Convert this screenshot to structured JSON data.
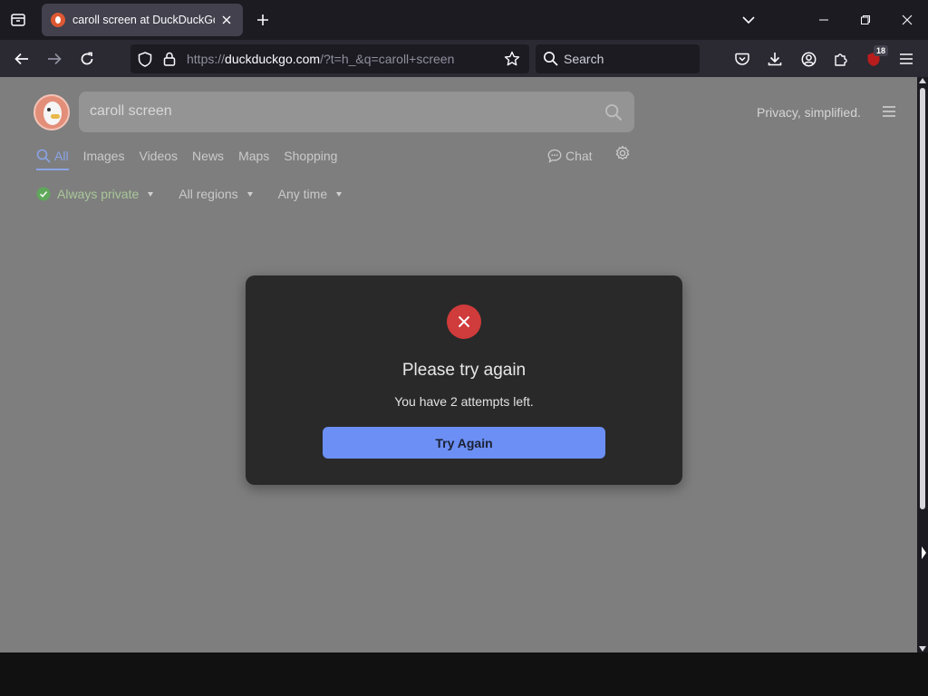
{
  "browser": {
    "tab_title": "caroll screen at DuckDuckGo",
    "url_prefix": "https://",
    "url_host": "duckduckgo.com",
    "url_path": "/?t=h_&q=caroll+screen",
    "search_placeholder": "Search",
    "extensions_badge": "18"
  },
  "ddg": {
    "query": "caroll screen",
    "tagline": "Privacy, simplified.",
    "tabs": [
      {
        "label": "All",
        "active": true
      },
      {
        "label": "Images"
      },
      {
        "label": "Videos"
      },
      {
        "label": "News"
      },
      {
        "label": "Maps"
      },
      {
        "label": "Shopping"
      }
    ],
    "chat_label": "Chat",
    "filters": {
      "privacy": "Always private",
      "region": "All regions",
      "time": "Any time"
    }
  },
  "modal": {
    "title": "Please try again",
    "message": "You have 2 attempts left.",
    "button_label": "Try Again"
  },
  "colors": {
    "accent": "#6b8ff5",
    "error": "#d03b3b",
    "active_tab": "#8aa4e6"
  }
}
